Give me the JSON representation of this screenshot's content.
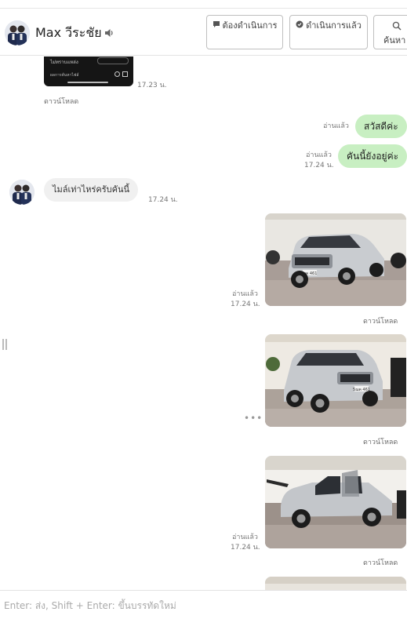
{
  "header": {
    "contact_name": "Max วีระชัย",
    "buttons": {
      "todo": "ต้องดำเนินการ",
      "done": "ดำเนินการแล้ว",
      "search": "ค้นหา"
    }
  },
  "messages": {
    "top_image": {
      "line1": "ไม่ทราบแหล่ง",
      "line2": "ผลการค้นหาไฟล์",
      "time": "17.23 น.",
      "download": "ดาวน์โหลด"
    },
    "out1": {
      "text": "สวัสดีค่ะ",
      "read": "อ่านแล้ว"
    },
    "out2": {
      "text": "คันนี้ยังอยู่ค่ะ",
      "read": "อ่านแล้ว",
      "time": "17.24 น."
    },
    "in1": {
      "text": "ไมล์เท่าไหร่ครับคันนี้",
      "time": "17.24 น."
    },
    "img1": {
      "read": "อ่านแล้ว",
      "time": "17.24 น.",
      "download": "ดาวน์โหลด",
      "plate": "ฌค 461"
    },
    "img2": {
      "more": "•••",
      "download": "ดาวน์โหลด",
      "plate": "5ฌค 461"
    },
    "img3": {
      "read": "อ่านแล้ว",
      "time": "17.24 น.",
      "download": "ดาวน์โหลด"
    }
  },
  "composer": {
    "placeholder": "Enter: ส่ง, Shift + Enter: ขึ้นบรรทัดใหม่"
  },
  "colors": {
    "outgoing_bubble": "#c8efc2",
    "incoming_bubble": "#f0f0f0"
  }
}
